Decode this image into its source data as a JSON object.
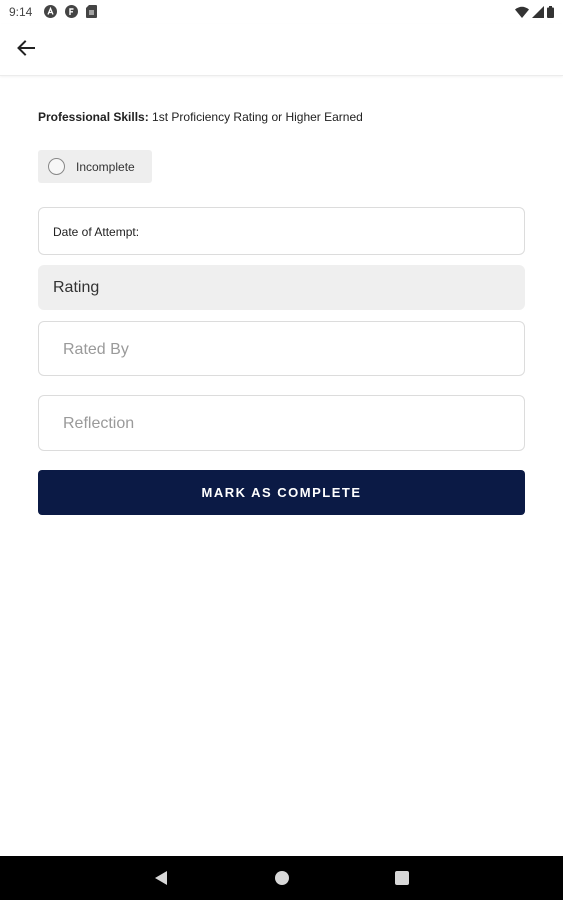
{
  "status_bar": {
    "time": "9:14",
    "left_icons": [
      "a-circle-icon",
      "f-circle-icon",
      "sim-card-icon"
    ],
    "right_icons": [
      "wifi-icon",
      "signal-icon",
      "battery-icon"
    ]
  },
  "app_bar": {
    "back_icon": "arrow-left-icon"
  },
  "task": {
    "category": "Professional Skills:",
    "title": " 1st Proficiency Rating or Higher Earned"
  },
  "status": {
    "label": "Incomplete"
  },
  "form": {
    "date_label": "Date of Attempt:",
    "rating_label": "Rating",
    "rated_by_placeholder": "Rated By",
    "reflection_placeholder": "Reflection"
  },
  "actions": {
    "complete_label": "MARK AS COMPLETE"
  },
  "nav_bar": {
    "icons": [
      "back-triangle-icon",
      "home-circle-icon",
      "recents-square-icon"
    ]
  },
  "colors": {
    "primary": "#0b1a45",
    "chip_bg": "#eeeeee",
    "field_border": "#dcdcdc"
  }
}
